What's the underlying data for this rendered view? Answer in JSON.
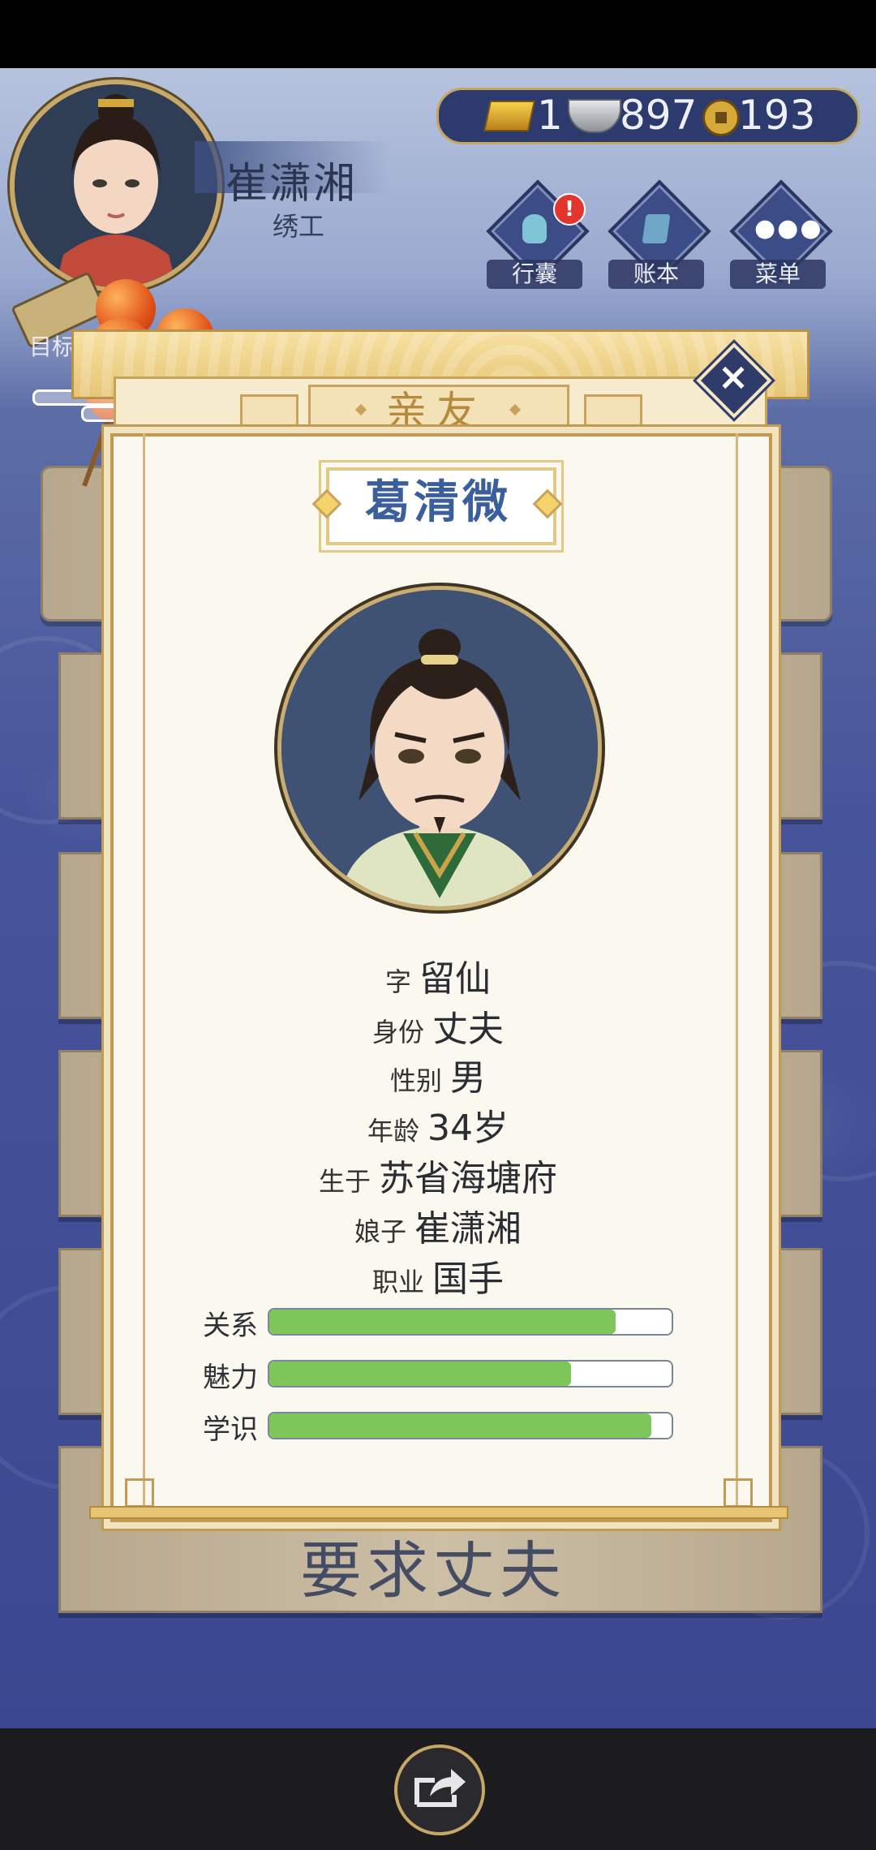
{
  "header": {
    "player_name": "崔潇湘",
    "player_job": "绣工",
    "currency": {
      "gold": "1",
      "silver": "897",
      "coins": "193"
    },
    "buttons": [
      {
        "label": "行囊",
        "badge": "!"
      },
      {
        "label": "账本"
      },
      {
        "label": "菜单"
      }
    ],
    "target_label": "目标"
  },
  "background": {
    "bottom_card_text": "要求丈夫"
  },
  "modal": {
    "title": "亲友",
    "npc_name": "葛清微",
    "fields": [
      {
        "key": "字",
        "value": "留仙"
      },
      {
        "key": "身份",
        "value": "丈夫"
      },
      {
        "key": "性别",
        "value": "男"
      },
      {
        "key": "年龄",
        "value": "34岁"
      },
      {
        "key": "生于",
        "value": "苏省海塘府"
      },
      {
        "key": "娘子",
        "value": "崔潇湘"
      },
      {
        "key": "职业",
        "value": "国手"
      }
    ],
    "stats": [
      {
        "label": "关系",
        "fraction": 0.86
      },
      {
        "label": "魅力",
        "fraction": 0.75
      },
      {
        "label": "学识",
        "fraction": 0.95
      }
    ]
  },
  "colors": {
    "bar_fill": "#7cc65a",
    "title_gold": "#b48a3c",
    "name_blue": "#3a5f9c"
  },
  "icons": [
    "gold-bar-icon",
    "silver-ingot-icon",
    "copper-coin-icon",
    "close-icon",
    "share-icon"
  ]
}
